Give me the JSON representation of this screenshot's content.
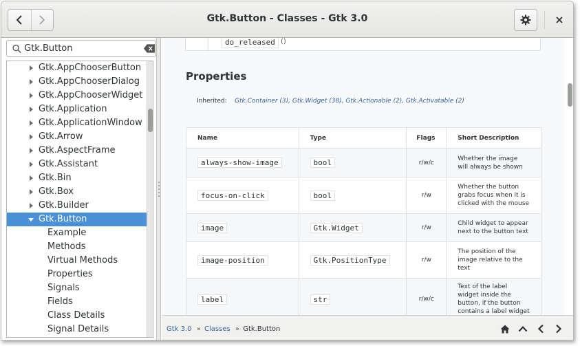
{
  "window": {
    "title": "Gtk.Button - Classes - Gtk 3.0"
  },
  "search": {
    "value": "Gtk.Button"
  },
  "tree": {
    "items": [
      {
        "label": "Gtk.AppChooserButton",
        "type": "class"
      },
      {
        "label": "Gtk.AppChooserDialog",
        "type": "class"
      },
      {
        "label": "Gtk.AppChooserWidget",
        "type": "class"
      },
      {
        "label": "Gtk.Application",
        "type": "class"
      },
      {
        "label": "Gtk.ApplicationWindow",
        "type": "class"
      },
      {
        "label": "Gtk.Arrow",
        "type": "class"
      },
      {
        "label": "Gtk.AspectFrame",
        "type": "class"
      },
      {
        "label": "Gtk.Assistant",
        "type": "class"
      },
      {
        "label": "Gtk.Bin",
        "type": "class"
      },
      {
        "label": "Gtk.Box",
        "type": "class"
      },
      {
        "label": "Gtk.Builder",
        "type": "class"
      },
      {
        "label": "Gtk.Button",
        "type": "selected"
      },
      {
        "label": "Example",
        "type": "child"
      },
      {
        "label": "Methods",
        "type": "child"
      },
      {
        "label": "Virtual Methods",
        "type": "child"
      },
      {
        "label": "Properties",
        "type": "child"
      },
      {
        "label": "Signals",
        "type": "child"
      },
      {
        "label": "Fields",
        "type": "child"
      },
      {
        "label": "Class Details",
        "type": "child"
      },
      {
        "label": "Signal Details",
        "type": "child"
      }
    ]
  },
  "content": {
    "top_method": "do_released",
    "top_paren": "()",
    "section_title": "Properties",
    "inherited_label": "Inherited:",
    "inherited_links": "Gtk.Container (3), Gtk.Widget (38), Gtk.Actionable (2), Gtk.Activatable (2)",
    "table": {
      "headers": [
        "Name",
        "Type",
        "Flags",
        "Short Description"
      ],
      "rows": [
        {
          "name": "always-show-image",
          "type": "bool",
          "flags": "r/w/c",
          "desc": "Whether the image will always be shown"
        },
        {
          "name": "focus-on-click",
          "type": "bool",
          "flags": "r/w",
          "desc": "Whether the button grabs focus when it is clicked with the mouse"
        },
        {
          "name": "image",
          "type": "Gtk.Widget",
          "flags": "r/w",
          "desc": "Child widget to appear next to the button text"
        },
        {
          "name": "image-position",
          "type": "Gtk.PositionType",
          "flags": "r/w",
          "desc": "The position of the image relative to the text"
        },
        {
          "name": "label",
          "type": "str",
          "flags": "r/w/c",
          "desc": "Text of the label widget inside the button, if the button contains a label widget"
        }
      ]
    }
  },
  "breadcrumb": {
    "items": [
      {
        "label": "Gtk 3.0",
        "link": true
      },
      {
        "label": "Classes",
        "link": true
      },
      {
        "label": "Gtk.Button",
        "link": false
      }
    ],
    "separator": "»"
  },
  "colors": {
    "selection": "#4a90d9",
    "link": "#3465a4"
  },
  "icons": [
    "go-back-icon",
    "go-forward-icon",
    "gear-icon",
    "close-icon",
    "search-icon",
    "clear-icon",
    "home-icon",
    "up-icon",
    "previous-icon",
    "next-icon"
  ]
}
